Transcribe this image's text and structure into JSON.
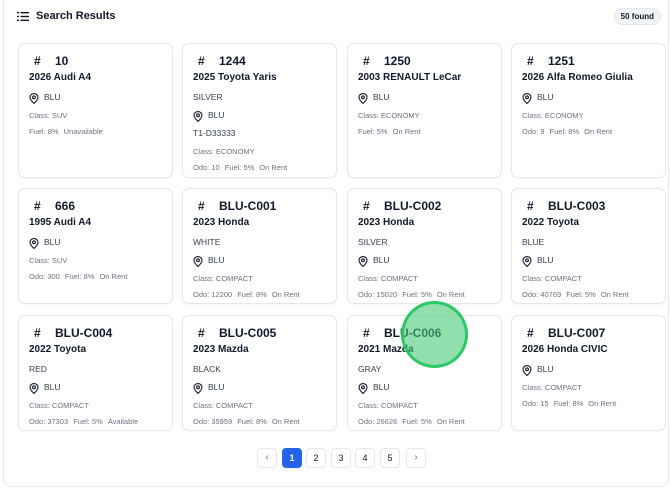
{
  "header": {
    "title": "Search Results",
    "count_badge": "50 found",
    "icon": "list-icon"
  },
  "cards": [
    {
      "code": "10",
      "name": "2026 Audi A4",
      "location": "BLU",
      "class": "Class: SUV",
      "stats": [
        "Fuel: 8%",
        "Unavailable"
      ]
    },
    {
      "code": "1244",
      "name": "2025 Toyota Yaris",
      "color": "SILVER",
      "location": "BLU",
      "plate": "T1-D33333",
      "class": "Class: ECONOMY",
      "stats": [
        "Odo: 10",
        "Fuel: 5%",
        "On Rent"
      ]
    },
    {
      "code": "1250",
      "name": "2003 RENAULT LeCar",
      "location": "BLU",
      "class": "Class: ECONOMY",
      "stats": [
        "Fuel: 5%",
        "On Rent"
      ]
    },
    {
      "code": "1251",
      "name": "2026 Alfa Romeo Giulia",
      "location": "BLU",
      "class": "Class: ECONOMY",
      "stats": [
        "Odo: 9",
        "Fuel: 8%",
        "On Rent"
      ]
    },
    {
      "code": "666",
      "name": "1995 Audi A4",
      "location": "BLU",
      "class": "Class: SUV",
      "stats": [
        "Odo: 300",
        "Fuel: 8%",
        "On Rent"
      ]
    },
    {
      "code": "BLU-C001",
      "name": "2023 Honda",
      "color": "WHITE",
      "location": "BLU",
      "class": "Class: COMPACT",
      "stats": [
        "Odo: 12200",
        "Fuel: 8%",
        "On Rent"
      ]
    },
    {
      "code": "BLU-C002",
      "name": "2023 Honda",
      "color": "SILVER",
      "location": "BLU",
      "class": "Class: COMPACT",
      "stats": [
        "Odo: 15020",
        "Fuel: 5%",
        "On Rent"
      ]
    },
    {
      "code": "BLU-C003",
      "name": "2022 Toyota",
      "color": "BLUE",
      "location": "BLU",
      "class": "Class: COMPACT",
      "stats": [
        "Odo: 40769",
        "Fuel: 5%",
        "On Rent"
      ]
    },
    {
      "code": "BLU-C004",
      "name": "2022 Toyota",
      "color": "RED",
      "location": "BLU",
      "class": "Class: COMPACT",
      "stats": [
        "Odo: 37303",
        "Fuel: 5%",
        "Available"
      ]
    },
    {
      "code": "BLU-C005",
      "name": "2023 Mazda",
      "color": "BLACK",
      "location": "BLU",
      "class": "Class: COMPACT",
      "stats": [
        "Odo: 35959",
        "Fuel: 8%",
        "On Rent"
      ]
    },
    {
      "code": "BLU-C006",
      "name": "2021 Mazda",
      "color": "GRAY",
      "location": "BLU",
      "class": "Class: COMPACT",
      "stats": [
        "Odo: 26626",
        "Fuel: 5%",
        "On Rent"
      ]
    },
    {
      "code": "BLU-C007",
      "name": "2026 Honda CIVIC",
      "location": "BLU",
      "class": "Class: COMPACT",
      "stats": [
        "Odo: 15",
        "Fuel: 8%",
        "On Rent"
      ]
    }
  ],
  "pagination": {
    "prev": "‹",
    "next": "›",
    "pages": [
      "1",
      "2",
      "3",
      "4",
      "5"
    ],
    "current": "1"
  },
  "colors": {
    "accent": "#2563eb",
    "cursor": "#22c55e"
  }
}
